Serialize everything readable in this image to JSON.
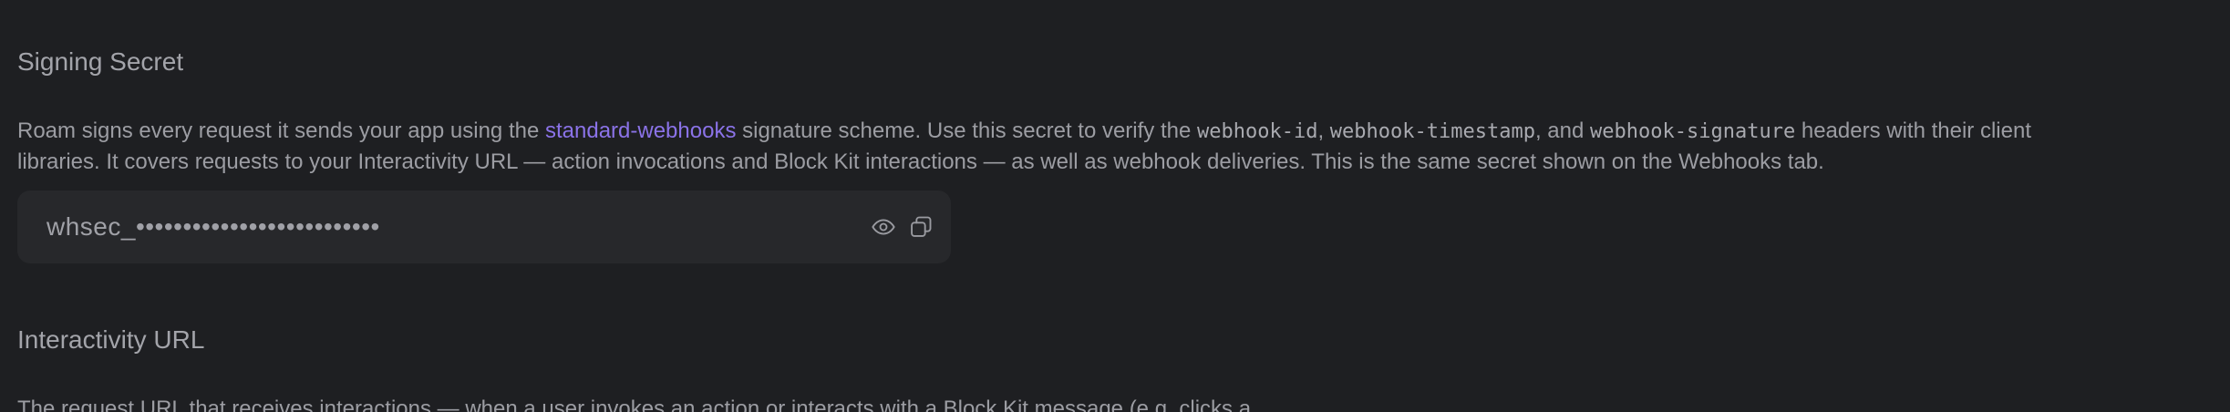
{
  "signing_secret": {
    "title": "Signing Secret",
    "description": {
      "part1": "Roam signs every request it sends your app using the ",
      "link_text": "standard-webhooks",
      "part2": " signature scheme. Use this secret to verify the ",
      "code1": "webhook-id",
      "sep1": ", ",
      "code2": "webhook-timestamp",
      "sep2": ", and ",
      "code3": "webhook-signature",
      "part3": " headers with their client libraries. It covers requests to your Interactivity URL — action invocations and Block Kit interactions — as well as webhook deliveries. This is the same secret shown on the Webhooks tab."
    },
    "masked_value": "whsec_••••••••••••••••••••••••••",
    "icons": {
      "reveal": "eye-icon",
      "copy": "copy-icon"
    }
  },
  "interactivity": {
    "title": "Interactivity URL",
    "description": "The request URL that receives interactions — when a user invokes an action or interacts with a Block Kit message (e.g. clicks a"
  },
  "colors": {
    "background": "#1e1f22",
    "secret_box": "#27282b",
    "link": "#8b73e8",
    "text": "#9c9da3"
  }
}
